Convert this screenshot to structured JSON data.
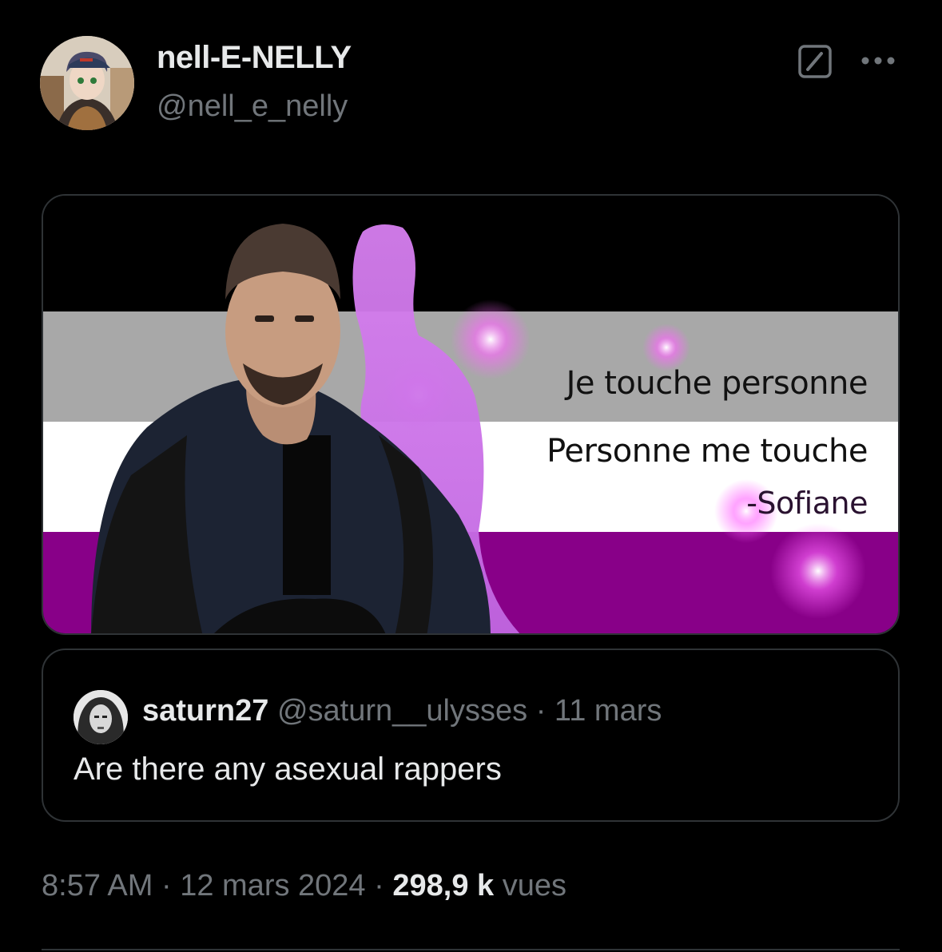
{
  "author": {
    "display_name": "nell-E-NELLY",
    "handle": "@nell_e_nelly",
    "avatar_icon": "anime-avatar"
  },
  "header_actions": {
    "grok_icon": "grok-slash-icon",
    "more_icon": "more-dots-icon"
  },
  "media": {
    "lines": [
      "Je touche personne",
      "Personne me touche",
      "-Sofiane"
    ],
    "flag_colors": [
      "#000000",
      "#a5a5a5",
      "#ffffff",
      "#800080"
    ]
  },
  "quote": {
    "name": "saturn27",
    "handle": "@saturn__ulysses",
    "separator": "·",
    "date": "11 mars",
    "text": "Are there any asexual rappers"
  },
  "meta": {
    "time": "8:57 AM",
    "sep1": "·",
    "date": "12 mars 2024",
    "sep2": "·",
    "views_count": "298,9 k",
    "views_label": "vues"
  },
  "colors": {
    "background": "#000000",
    "text_primary": "#e7e9ea",
    "text_secondary": "#71767b",
    "border": "#2f3336"
  }
}
